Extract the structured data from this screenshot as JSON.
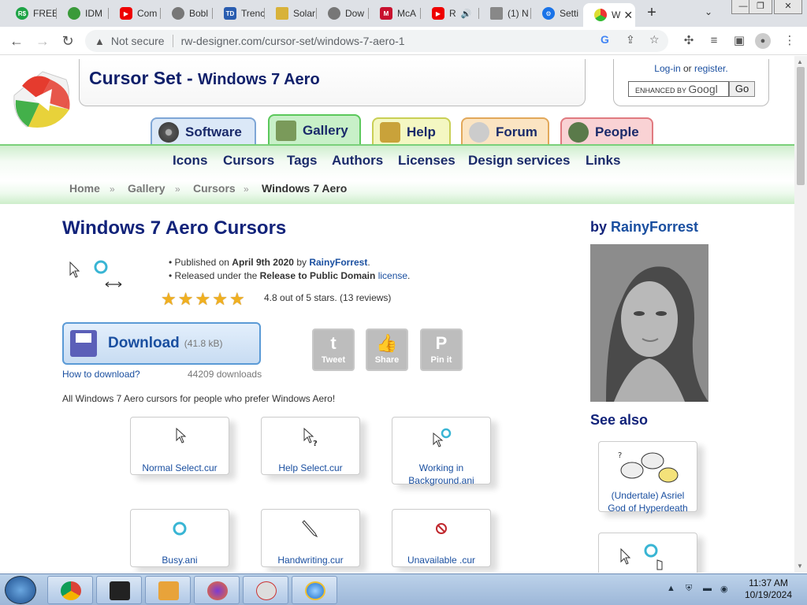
{
  "browser": {
    "tabs": [
      {
        "label": "FREE"
      },
      {
        "label": "IDM"
      },
      {
        "label": "Com"
      },
      {
        "label": "Bobl"
      },
      {
        "label": "Trenc"
      },
      {
        "label": "Solar"
      },
      {
        "label": "Dow"
      },
      {
        "label": "McA"
      },
      {
        "label": "R"
      },
      {
        "label": "(1) N"
      },
      {
        "label": "Setti"
      },
      {
        "label": "W"
      }
    ],
    "new_tab": "+",
    "tab_menu": "⌄",
    "window_controls": {
      "minimize": "—",
      "restore": "❐",
      "close": "✕"
    },
    "security_label": "Not secure",
    "url": "rw-designer.com/cursor-set/windows-7-aero-1"
  },
  "site": {
    "title_main": "Cursor Set - ",
    "title_sub": "Windows 7 Aero",
    "login": "Log-in",
    "or": " or ",
    "register": "register.",
    "search_placeholder": "ENHANCED BY ",
    "search_brand": "Googl",
    "search_go": "Go"
  },
  "nav_tabs": [
    {
      "label": "Software"
    },
    {
      "label": "Gallery"
    },
    {
      "label": "Help"
    },
    {
      "label": "Forum"
    },
    {
      "label": "People"
    }
  ],
  "subnav": [
    "Icons",
    "Cursors",
    "Tags",
    "Authors",
    "Licenses",
    "Design services",
    "Links"
  ],
  "breadcrumb": [
    "Home",
    "Gallery",
    "Cursors",
    "Windows 7 Aero"
  ],
  "content": {
    "heading": "Windows 7 Aero Cursors",
    "published_prefix": "Published on ",
    "published_date": "April 9th 2020",
    "by_word": " by ",
    "author": "RainyForrest",
    "period": ".",
    "released_prefix": "Released under the ",
    "license_name": "Release to Public Domain",
    "license_word": "license",
    "rating_text": "4.8 out of 5 stars. (13 reviews)",
    "stars": 5,
    "download_label": "Download",
    "download_size": "(41.8 kB)",
    "how_to": "How to download?",
    "downloads": "44209 downloads",
    "description": "All Windows 7 Aero cursors for people who prefer Windows Aero!",
    "share": [
      {
        "glyph": "t",
        "label": "Tweet"
      },
      {
        "glyph": "👍",
        "label": "Share"
      },
      {
        "glyph": "P",
        "label": "Pin it"
      }
    ],
    "cursors": [
      {
        "label": "Normal Select.cur",
        "icon": "arrow-cursor-icon"
      },
      {
        "label": "Help Select.cur",
        "icon": "help-cursor-icon"
      },
      {
        "label": "Working in Background.ani",
        "icon": "working-cursor-icon"
      },
      {
        "label": "Busy.ani",
        "icon": "busy-cursor-icon"
      },
      {
        "label": "Handwriting.cur",
        "icon": "pen-cursor-icon"
      },
      {
        "label": "Unavailable .cur",
        "icon": "unavailable-cursor-icon"
      }
    ]
  },
  "sidebar": {
    "by_prefix": "by ",
    "author": "RainyForrest",
    "see_also": "See also",
    "related": [
      {
        "label": "(Undertale) Asriel God of Hyperdeath"
      },
      {
        "label": ""
      }
    ]
  },
  "taskbar": {
    "time": "11:37 AM",
    "date": "10/19/2024"
  },
  "colors": {
    "heading": "#12237a",
    "link": "#1a4fa0",
    "nav_green": "#5bc85b"
  }
}
